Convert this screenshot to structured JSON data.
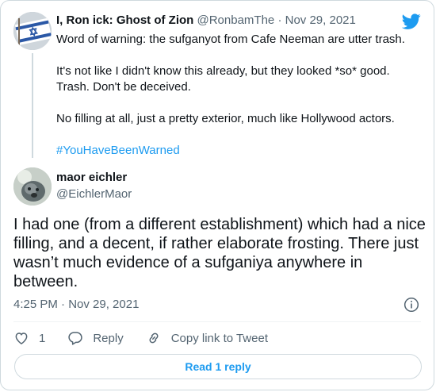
{
  "parent_tweet": {
    "display_name": "I, Ron ick: Ghost of Zion",
    "handle": "@RonbamThe",
    "separator": "·",
    "date": "Nov 29, 2021",
    "paragraphs": [
      "Word of warning: the sufganyot from Cafe Neeman are utter trash.",
      "It's not like I didn't know this already, but they looked *so* good. Trash. Don't be deceived.",
      "No filling at all, just a pretty exterior, much like Hollywood actors."
    ],
    "hashtag": "#YouHaveBeenWarned"
  },
  "reply_tweet": {
    "display_name": "maor eichler",
    "handle": "@EichlerMaor",
    "text": "I had one (from a different establishment) which had a nice filling, and a decent, if rather elaborate frosting. There just wasn’t much evidence of a sufganiya anywhere in between.",
    "timestamp": "4:25 PM · Nov 29, 2021"
  },
  "actions": {
    "like_count": "1",
    "reply_label": "Reply",
    "copy_label": "Copy link to Tweet"
  },
  "read_replies_label": "Read 1 reply",
  "colors": {
    "accent": "#1d9bf0",
    "secondary_text": "#536471",
    "border": "#cfd9de"
  },
  "icons": [
    "twitter-bird-icon",
    "info-icon",
    "heart-icon",
    "reply-icon",
    "link-icon"
  ]
}
